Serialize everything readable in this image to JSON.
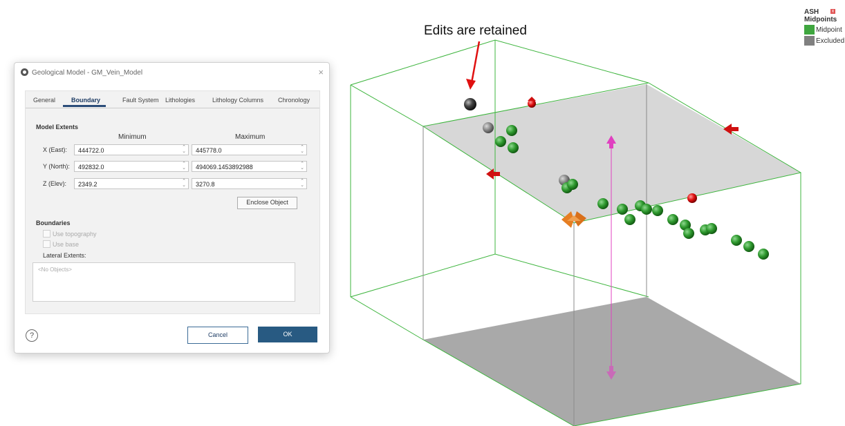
{
  "annotation": {
    "text": "Edits are retained"
  },
  "legend": {
    "title_line1": "ASH",
    "title_line2": "Midpoints",
    "close_glyph": "x",
    "items": [
      {
        "label": "Midpoint",
        "color": "#3fa63f"
      },
      {
        "label": "Excluded",
        "color": "#808080"
      }
    ]
  },
  "dialog": {
    "title": "Geological Model - GM_Vein_Model",
    "close_glyph": "×",
    "tabs": [
      "General",
      "Boundary",
      "Fault System",
      "Lithologies",
      "Lithology Columns",
      "Chronology"
    ],
    "active_tab": "Boundary",
    "model_extents": {
      "label": "Model Extents",
      "min_header": "Minimum",
      "max_header": "Maximum",
      "rows": [
        {
          "label": "X (East):",
          "min": "444722.0",
          "max": "445778.0"
        },
        {
          "label": "Y (North):",
          "min": "492832.0",
          "max": "494069.1453892988"
        },
        {
          "label": "Z (Elev):",
          "min": "2349.2",
          "max": "3270.8"
        }
      ],
      "enclose_button": "Enclose Object"
    },
    "boundaries": {
      "label": "Boundaries",
      "use_topography": "Use topography",
      "use_base": "Use base",
      "lateral_label": "Lateral Extents:",
      "objects_placeholder": "<No Objects>"
    },
    "help_glyph": "?",
    "cancel_button": "Cancel",
    "ok_button": "OK"
  },
  "colors": {
    "box_edge": "#3cb43c",
    "top_plane": "#d2d2d2",
    "bottom_plane": "#a8a8a8",
    "midpoint": "#3fa63f",
    "excluded": "#808080",
    "control_arrow": "#e01010",
    "manipulator": "#e67e22",
    "axis_arrow": "#e040c0",
    "accent_blue": "#285a82"
  }
}
